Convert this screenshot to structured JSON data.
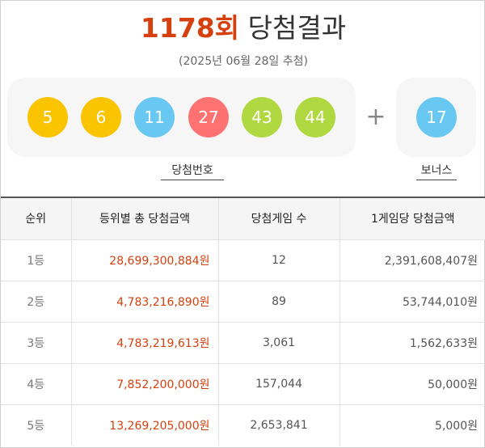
{
  "header": {
    "draw_no": "1178회",
    "title_suffix": "당첨결과",
    "date": "(2025년 06월 28일 추첨)"
  },
  "colors": {
    "accent": "#d6400f",
    "ball_yellow": "#fbc400",
    "ball_blue": "#69c8f2",
    "ball_red": "#ff7272",
    "ball_green": "#b0d840"
  },
  "winning": {
    "caption": "당첨번호",
    "balls": [
      {
        "number": "5",
        "color": "#fbc400"
      },
      {
        "number": "6",
        "color": "#fbc400"
      },
      {
        "number": "11",
        "color": "#69c8f2"
      },
      {
        "number": "27",
        "color": "#ff7272"
      },
      {
        "number": "43",
        "color": "#b0d840"
      },
      {
        "number": "44",
        "color": "#b0d840"
      }
    ]
  },
  "plus_sign": "+",
  "bonus": {
    "caption": "보너스",
    "number": "17",
    "color": "#69c8f2"
  },
  "table": {
    "headers": [
      "순위",
      "등위별 총 당첨금액",
      "당첨게임 수",
      "1게임당 당첨금액"
    ],
    "rows": [
      {
        "rank": "1등",
        "total": "28,699,300,884원",
        "count": "12",
        "per_game": "2,391,608,407원"
      },
      {
        "rank": "2등",
        "total": "4,783,216,890원",
        "count": "89",
        "per_game": "53,744,010원"
      },
      {
        "rank": "3등",
        "total": "4,783,219,613원",
        "count": "3,061",
        "per_game": "1,562,633원"
      },
      {
        "rank": "4등",
        "total": "7,852,200,000원",
        "count": "157,044",
        "per_game": "50,000원"
      },
      {
        "rank": "5등",
        "total": "13,269,205,000원",
        "count": "2,653,841",
        "per_game": "5,000원"
      }
    ]
  }
}
